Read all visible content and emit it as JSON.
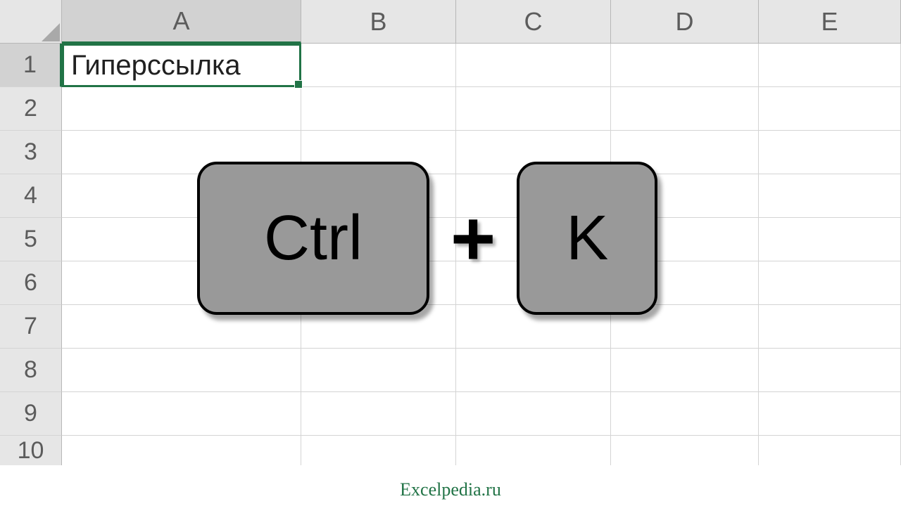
{
  "columns": [
    "A",
    "B",
    "C",
    "D",
    "E"
  ],
  "rows": [
    "1",
    "2",
    "3",
    "4",
    "5",
    "6",
    "7",
    "8",
    "9",
    "10"
  ],
  "active_cell": {
    "row": 0,
    "col": 0,
    "value": "Гиперссылка"
  },
  "shortcut": {
    "key1": "Ctrl",
    "separator": "+",
    "key2": "K"
  },
  "watermark": "Excelpedia.ru"
}
